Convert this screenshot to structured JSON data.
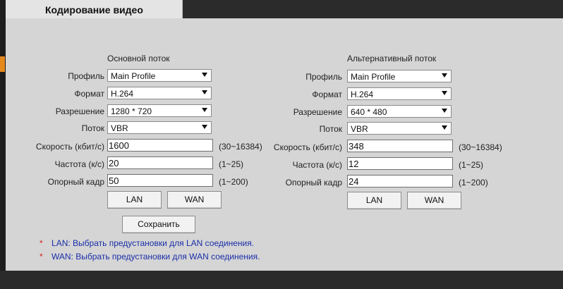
{
  "header": {
    "title": "Кодирование видео"
  },
  "main_stream": {
    "title": "Основной поток",
    "profile": {
      "label": "Профиль",
      "value": "Main Profile"
    },
    "format": {
      "label": "Формат",
      "value": "H.264"
    },
    "resolution": {
      "label": "Разрешение",
      "value": "1280 * 720"
    },
    "stream": {
      "label": "Поток",
      "value": "VBR"
    },
    "bitrate": {
      "label": "Скорость (кбит/с)",
      "value": "1600",
      "range": "(30~16384)"
    },
    "fps": {
      "label": "Частота (к/с)",
      "value": "20",
      "range": "(1~25)"
    },
    "keyframe": {
      "label": "Опорный кадр",
      "value": "50",
      "range": "(1~200)"
    },
    "lan_button": "LAN",
    "wan_button": "WAN"
  },
  "alt_stream": {
    "title": "Альтернативный поток",
    "profile": {
      "label": "Профиль",
      "value": "Main Profile"
    },
    "format": {
      "label": "Формат",
      "value": "H.264"
    },
    "resolution": {
      "label": "Разрешение",
      "value": "640 * 480"
    },
    "stream": {
      "label": "Поток",
      "value": "VBR"
    },
    "bitrate": {
      "label": "Скорость (кбит/с)",
      "value": "348",
      "range": "(30~16384)"
    },
    "fps": {
      "label": "Частота (к/с)",
      "value": "12",
      "range": "(1~25)"
    },
    "keyframe": {
      "label": "Опорный кадр",
      "value": "24",
      "range": "(1~200)"
    },
    "lan_button": "LAN",
    "wan_button": "WAN"
  },
  "save_button": "Сохранить",
  "notes": [
    {
      "star": "*",
      "text": "LAN: Выбрать предустановки для LAN соединения."
    },
    {
      "star": "*",
      "text": "WAN: Выбрать предустановки для WAN соединения."
    }
  ]
}
